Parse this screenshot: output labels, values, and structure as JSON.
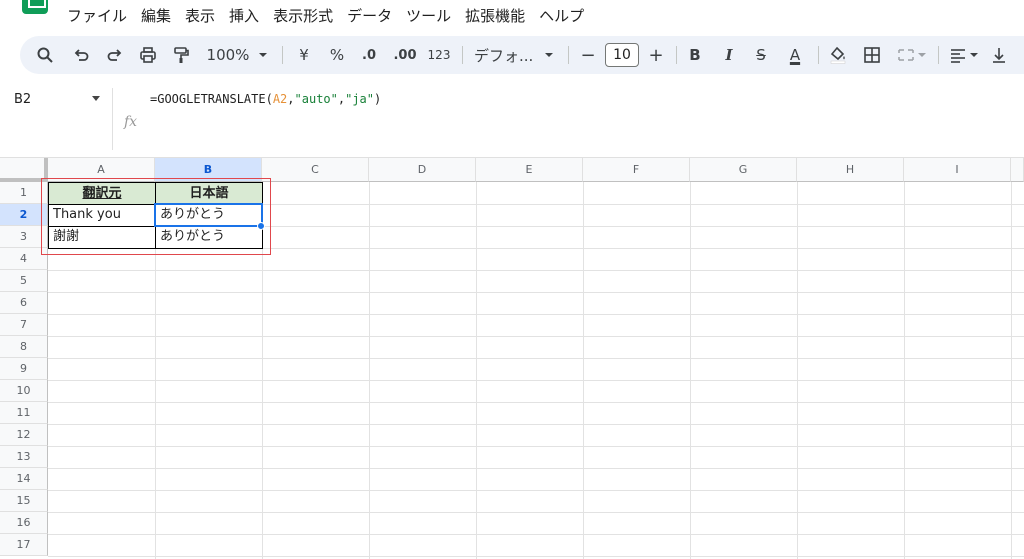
{
  "menu": {
    "items": [
      "ファイル",
      "編集",
      "表示",
      "挿入",
      "表示形式",
      "データ",
      "ツール",
      "拡張機能",
      "ヘルプ"
    ]
  },
  "toolbar": {
    "zoom": "100%",
    "currency": "¥",
    "percent": "%",
    "dec_decrease": ".0",
    "dec_increase": ".00",
    "number_format": "123",
    "font": "デフォ...",
    "minus": "−",
    "font_size": "10",
    "plus": "+",
    "bold": "B",
    "italic": "I",
    "strike": "S",
    "text_color": "A"
  },
  "formula_bar": {
    "name_box": "B2",
    "fx": "fx",
    "formula_prefix": "=GOOGLETRANSLATE(",
    "formula_ref": "A2",
    "formula_sep1": ",",
    "formula_str1": "\"auto\"",
    "formula_sep2": ",",
    "formula_str2": "\"ja\"",
    "formula_suffix": ")"
  },
  "grid": {
    "columns": [
      "A",
      "B",
      "C",
      "D",
      "E",
      "F",
      "G",
      "H",
      "I"
    ],
    "rows": [
      "1",
      "2",
      "3",
      "4",
      "5",
      "6",
      "7",
      "8",
      "9",
      "10",
      "11",
      "12",
      "13",
      "14",
      "15",
      "16",
      "17"
    ],
    "cells": {
      "A1": "翻訳元",
      "B1": "日本語",
      "A2": "Thank you",
      "B2": "ありがとう",
      "A3": "謝謝",
      "B3": "ありがとう"
    }
  },
  "colors": {
    "accent": "#1a73e8",
    "header_fill": "#d9ead3",
    "highlight_box": "#e0474c",
    "toolbar_bg": "#eef2f9"
  }
}
